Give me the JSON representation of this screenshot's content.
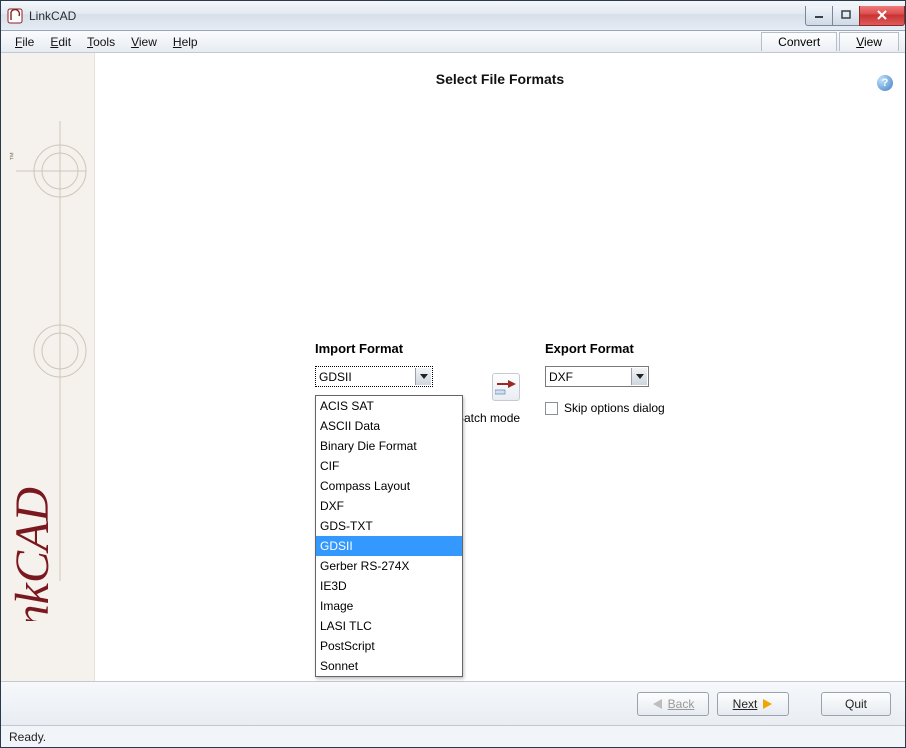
{
  "titlebar": {
    "title": "LinkCAD"
  },
  "menubar": {
    "items": [
      {
        "label": "File",
        "accel": "F"
      },
      {
        "label": "Edit",
        "accel": "E"
      },
      {
        "label": "Tools",
        "accel": "T"
      },
      {
        "label": "View",
        "accel": "V"
      },
      {
        "label": "Help",
        "accel": "H"
      }
    ],
    "modes": {
      "convert": "Convert",
      "view": "View",
      "view_accel": "V"
    }
  },
  "page": {
    "title": "Select File Formats"
  },
  "import": {
    "label": "Import Format",
    "selected": "GDSII",
    "options": [
      "ACIS SAT",
      "ASCII Data",
      "Binary Die Format",
      "CIF",
      "Compass Layout",
      "DXF",
      "GDS-TXT",
      "GDSII",
      "Gerber RS-274X",
      "IE3D",
      "Image",
      "LASI TLC",
      "PostScript",
      "Sonnet"
    ],
    "batch_label": "Batch mode"
  },
  "export": {
    "label": "Export Format",
    "selected": "DXF",
    "skip_label": "Skip options dialog"
  },
  "nav": {
    "back": "Back",
    "next": "Next",
    "quit": "Quit"
  },
  "status": {
    "text": "Ready."
  }
}
